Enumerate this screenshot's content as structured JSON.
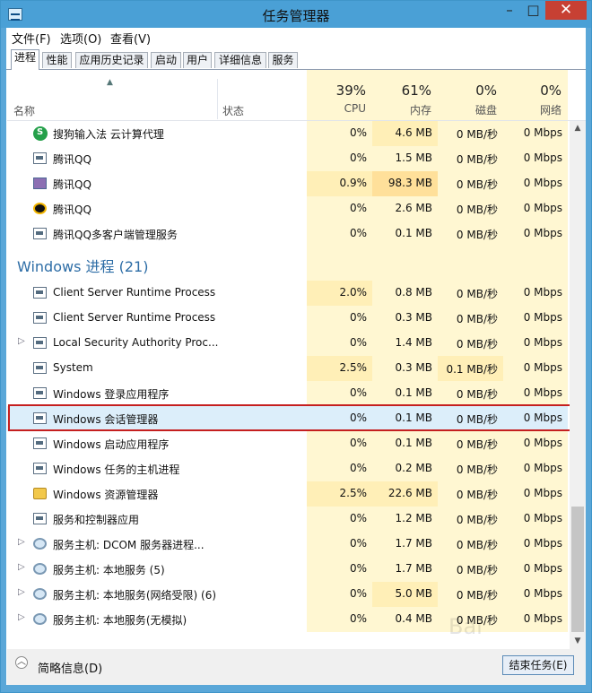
{
  "window": {
    "title": "任务管理器",
    "minimize_symbol": "–",
    "maximize_symbol": "□",
    "close_symbol": "✕"
  },
  "menu": {
    "items": [
      "文件(F)",
      "选项(O)",
      "查看(V)"
    ]
  },
  "tabs": [
    "进程",
    "性能",
    "应用历史记录",
    "启动",
    "用户",
    "详细信息",
    "服务"
  ],
  "columns": {
    "name": "名称",
    "status": "状态",
    "cpu": {
      "label": "CPU",
      "percent": "39%"
    },
    "memory": {
      "label": "内存",
      "percent": "61%"
    },
    "disk": {
      "label": "磁盘",
      "percent": "0%"
    },
    "network": {
      "label": "网络",
      "percent": "0%"
    }
  },
  "rows": [
    {
      "type": "process",
      "icon": "sogou-icon",
      "expandable": false,
      "name": "搜狗输入法 云计算代理",
      "cpu": "0%",
      "memory": "4.6 MB",
      "disk": "0 MB/秒",
      "network": "0 Mbps"
    },
    {
      "type": "process",
      "icon": "window-app-icon",
      "expandable": false,
      "name": "腾讯QQ",
      "cpu": "0%",
      "memory": "1.5 MB",
      "disk": "0 MB/秒",
      "network": "0 Mbps"
    },
    {
      "type": "process",
      "icon": "qq-avatar-icon",
      "expandable": false,
      "name": "腾讯QQ",
      "cpu": "0.9%",
      "memory": "98.3 MB",
      "disk": "0 MB/秒",
      "network": "0 Mbps"
    },
    {
      "type": "process",
      "icon": "qq-penguin-icon",
      "expandable": false,
      "name": "腾讯QQ",
      "cpu": "0%",
      "memory": "2.6 MB",
      "disk": "0 MB/秒",
      "network": "0 Mbps"
    },
    {
      "type": "process",
      "icon": "window-app-icon",
      "expandable": false,
      "name": "腾讯QQ多客户端管理服务",
      "cpu": "0%",
      "memory": "0.1 MB",
      "disk": "0 MB/秒",
      "network": "0 Mbps"
    },
    {
      "type": "group",
      "name": "Windows 进程 (21)"
    },
    {
      "type": "process",
      "icon": "window-app-icon",
      "expandable": false,
      "name": "Client Server Runtime Process",
      "cpu": "2.0%",
      "memory": "0.8 MB",
      "disk": "0 MB/秒",
      "network": "0 Mbps"
    },
    {
      "type": "process",
      "icon": "window-app-icon",
      "expandable": false,
      "name": "Client Server Runtime Process",
      "cpu": "0%",
      "memory": "0.3 MB",
      "disk": "0 MB/秒",
      "network": "0 Mbps"
    },
    {
      "type": "process",
      "icon": "window-app-icon",
      "expandable": true,
      "name": "Local Security Authority Proc...",
      "cpu": "0%",
      "memory": "1.4 MB",
      "disk": "0 MB/秒",
      "network": "0 Mbps"
    },
    {
      "type": "process",
      "icon": "window-app-icon",
      "expandable": false,
      "name": "System",
      "cpu": "2.5%",
      "memory": "0.3 MB",
      "disk": "0.1 MB/秒",
      "network": "0 Mbps"
    },
    {
      "type": "process",
      "icon": "window-app-icon",
      "expandable": false,
      "name": "Windows 登录应用程序",
      "cpu": "0%",
      "memory": "0.1 MB",
      "disk": "0 MB/秒",
      "network": "0 Mbps"
    },
    {
      "type": "process",
      "icon": "window-app-icon",
      "expandable": false,
      "name": "Windows 会话管理器",
      "cpu": "0%",
      "memory": "0.1 MB",
      "disk": "0 MB/秒",
      "network": "0 Mbps",
      "selected": true
    },
    {
      "type": "process",
      "icon": "window-app-icon",
      "expandable": false,
      "name": "Windows 启动应用程序",
      "cpu": "0%",
      "memory": "0.1 MB",
      "disk": "0 MB/秒",
      "network": "0 Mbps"
    },
    {
      "type": "process",
      "icon": "window-app-icon",
      "expandable": false,
      "name": "Windows 任务的主机进程",
      "cpu": "0%",
      "memory": "0.2 MB",
      "disk": "0 MB/秒",
      "network": "0 Mbps"
    },
    {
      "type": "process",
      "icon": "folder-icon",
      "expandable": false,
      "name": "Windows 资源管理器",
      "cpu": "2.5%",
      "memory": "22.6 MB",
      "disk": "0 MB/秒",
      "network": "0 Mbps"
    },
    {
      "type": "process",
      "icon": "window-app-icon",
      "expandable": false,
      "name": "服务和控制器应用",
      "cpu": "0%",
      "memory": "1.2 MB",
      "disk": "0 MB/秒",
      "network": "0 Mbps"
    },
    {
      "type": "process",
      "icon": "gear-icon",
      "expandable": true,
      "name": "服务主机: DCOM 服务器进程...",
      "cpu": "0%",
      "memory": "1.7 MB",
      "disk": "0 MB/秒",
      "network": "0 Mbps"
    },
    {
      "type": "process",
      "icon": "gear-icon",
      "expandable": true,
      "name": "服务主机: 本地服务 (5)",
      "cpu": "0%",
      "memory": "1.7 MB",
      "disk": "0 MB/秒",
      "network": "0 Mbps"
    },
    {
      "type": "process",
      "icon": "gear-icon",
      "expandable": true,
      "name": "服务主机: 本地服务(网络受限) (6)",
      "cpu": "0%",
      "memory": "5.0 MB",
      "disk": "0 MB/秒",
      "network": "0 Mbps"
    },
    {
      "type": "process",
      "icon": "gear-icon",
      "expandable": true,
      "name": "服务主机: 本地服务(无模拟)",
      "cpu": "0%",
      "memory": "0.4 MB",
      "disk": "0 MB/秒",
      "network": "0 Mbps"
    }
  ],
  "footer": {
    "collapse_symbol": "︿",
    "details_label": "简略信息(D)",
    "end_task_label": "结束任务(E)"
  },
  "scroll": {
    "up_symbol": "▲",
    "down_symbol": "▼"
  },
  "colors": {
    "titlebar": "#4aa0d6",
    "close_button": "#c74033",
    "cpu_light_yellow": "#fff7d2",
    "cpu_medium_yellow": "#ffefb7",
    "memory_strong_yellow": "#ffe09a",
    "selected_row": "#dceefa",
    "selection_outline": "#c51f1f"
  },
  "watermark": "Bai"
}
